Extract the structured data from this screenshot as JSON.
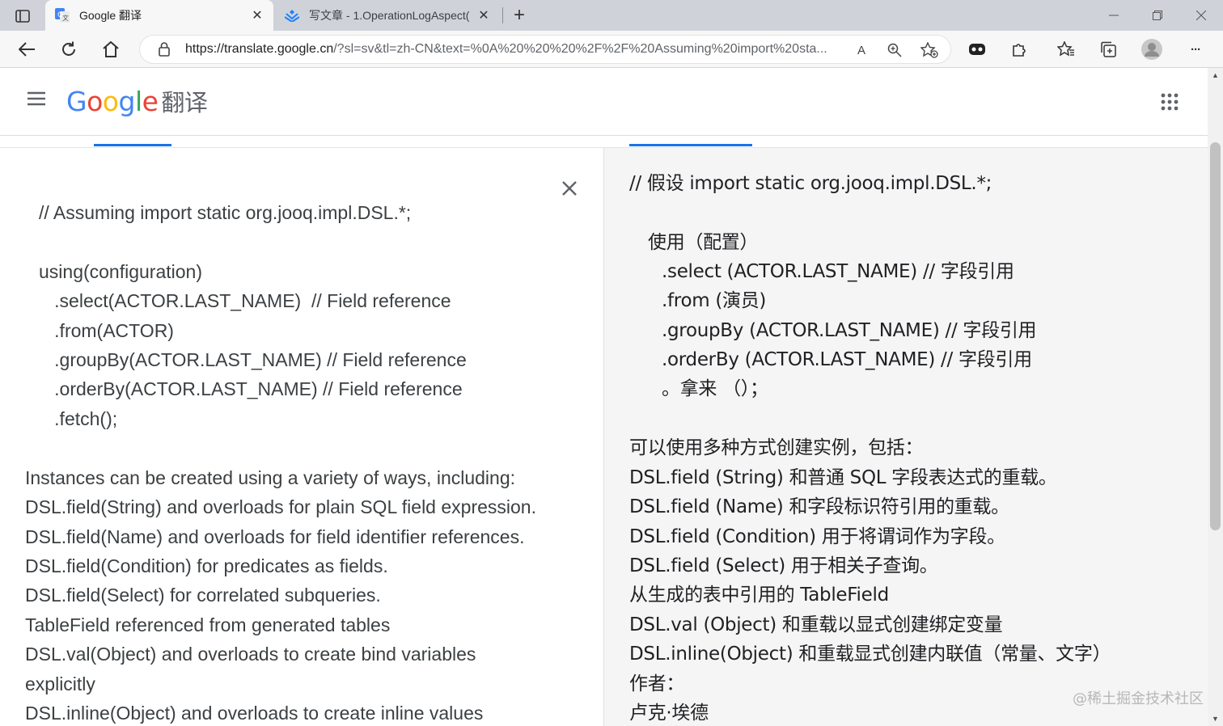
{
  "browser": {
    "tabs": [
      {
        "title": "Google 翻译",
        "active": true,
        "icon": "google-translate-icon"
      },
      {
        "title": "写文章 - 1.OperationLogAspect(",
        "active": false,
        "icon": "juejin-icon"
      }
    ],
    "url_host": "https://translate.google.cn",
    "url_rest": "/?sl=sv&tl=zh-CN&text=%0A%20%20%20%2F%2F%20Assuming%20import%20sta...",
    "read_aloud_glyph": "A",
    "new_tab_glyph": "+",
    "more_glyph": "···"
  },
  "header": {
    "logo_letters": [
      "G",
      "o",
      "o",
      "g",
      "l",
      "e"
    ],
    "product": "翻译"
  },
  "source": {
    "lines": [
      "// Assuming import static org.jooq.impl.DSL.*;",
      "using(configuration)",
      "   .select(ACTOR.LAST_NAME)  // Field reference",
      "   .from(ACTOR)",
      "   .groupBy(ACTOR.LAST_NAME) // Field reference",
      "   .orderBy(ACTOR.LAST_NAME) // Field reference",
      "   .fetch();",
      "Instances can be created using a variety of ways, including:",
      "DSL.field(String) and overloads for plain SQL field expression.",
      "DSL.field(Name) and overloads for field identifier references.",
      "DSL.field(Condition) for predicates as fields.",
      "DSL.field(Select) for correlated subqueries.",
      "TableField referenced from generated tables",
      "DSL.val(Object) and overloads to create bind variables",
      "explicitly",
      "DSL.inline(Object) and overloads to create inline values"
    ]
  },
  "target": {
    "lines": [
      "// 假设 import static org.jooq.impl.DSL.*;",
      "使用（配置）",
      ".select (ACTOR.LAST_NAME) // 字段引用",
      ".from (演员)",
      ".groupBy (ACTOR.LAST_NAME) // 字段引用",
      ".orderBy (ACTOR.LAST_NAME) // 字段引用",
      "。拿来 （）；",
      "可以使用多种方式创建实例，包括：",
      "DSL.field (String) 和普通 SQL 字段表达式的重载。",
      "DSL.field (Name) 和字段标识符引用的重载。",
      "DSL.field (Condition) 用于将谓词作为字段。",
      "DSL.field (Select) 用于相关子查询。",
      "从生成的表中引用的 TableField",
      "DSL.val (Object) 和重载以显式创建绑定变量",
      "DSL.inline(Object) 和重载显式创建内联值（常量、文字）",
      "作者：",
      "卢克·埃德"
    ]
  },
  "watermark": "@稀土掘金技术社区",
  "colors": {
    "tabstrip": "#cfd3d9",
    "toolbar": "#f7f7f7",
    "accent": "#1a73e8",
    "target_bg": "#f5f5f5"
  }
}
